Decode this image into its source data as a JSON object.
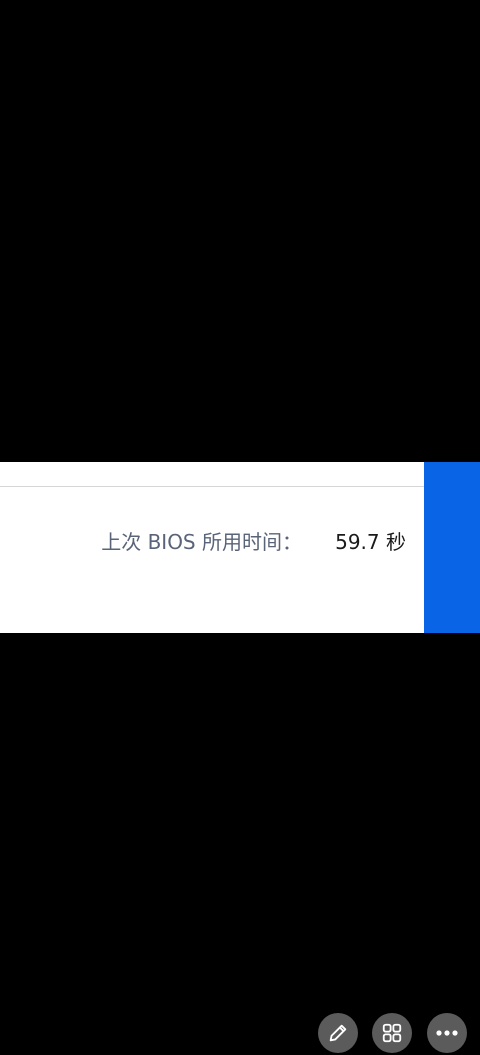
{
  "bios_info": {
    "label": "上次 BIOS 所用时间：",
    "value": "59.7 秒"
  },
  "colors": {
    "background": "#000000",
    "panel": "#ffffff",
    "accent_blue": "#0a64e6",
    "fab": "#5b5b5b"
  },
  "overlay_buttons": [
    {
      "icon": "pencil-icon"
    },
    {
      "icon": "grid-icon"
    },
    {
      "icon": "more-icon"
    }
  ]
}
